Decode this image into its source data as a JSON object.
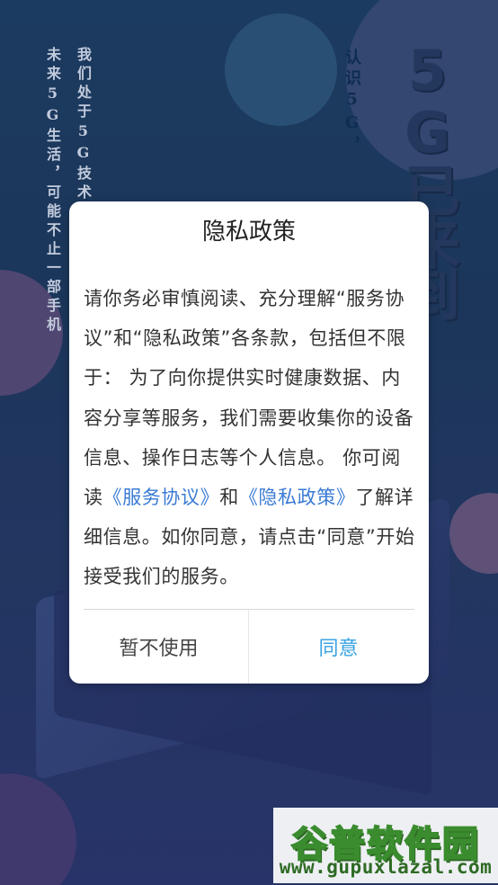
{
  "background": {
    "poster_line_1": "我们处于5G技术",
    "poster_line_2": "未来5G生活，可能不止一部手机",
    "poster_line_3": "认识5G，",
    "poster_headline": "5G已来到"
  },
  "dialog": {
    "title": "隐私政策",
    "body_part1": "请你务必审慎阅读、充分理解“服务协议”和“隐私政策”各条款，包括但不限于： 为了向你提供实时健康数据、内容分享等服务，我们需要收集你的设备信息、操作日志等个人信息。 你可阅读",
    "link_service_agreement": "《服务协议》",
    "body_and": "和",
    "link_privacy_policy": "《隐私政策》",
    "body_part2": "了解详细信息。如你同意，请点击“同意”开始接受我们的服务。",
    "decline_label": "暂不使用",
    "agree_label": "同意"
  },
  "watermark": {
    "logo_text": "谷普软件园",
    "url_text": "www.gupuxlazal.com"
  },
  "colors": {
    "link": "#3a7bd5",
    "agree": "#3aa3e3",
    "watermark_green": "#3a8c2e"
  }
}
